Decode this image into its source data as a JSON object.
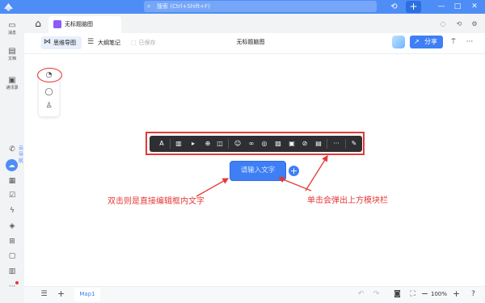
{
  "topbar": {
    "search_placeholder": "搜索 (Ctrl+Shift+F)",
    "plus_label": "+",
    "history_icon": "history-icon",
    "window_controls": [
      "minimize",
      "maximize",
      "close"
    ]
  },
  "rail": {
    "items": [
      {
        "icon": "chat-icon",
        "label": "消息"
      },
      {
        "icon": "document-icon",
        "label": "文档"
      },
      {
        "icon": "contacts-icon",
        "label": "通讯录"
      }
    ],
    "cloud_label": "云导航"
  },
  "tabstrip": {
    "tab_title": "无标题脑图"
  },
  "doc_toolbar": {
    "mindmap_label": "思维导图",
    "outline_label": "大纲笔记",
    "saved_label": "已保存",
    "title": "无标题脑图",
    "share_label": "分享",
    "more_label": "···"
  },
  "floating_bar": {
    "more_label": "···"
  },
  "node": {
    "placeholder": "请输入文字",
    "add_label": "+"
  },
  "annotations": {
    "left": "双击则是直接编辑框内文字",
    "right": "单击会弹出上方模块栏"
  },
  "bottombar": {
    "map_tab": "Map1",
    "zoom": "100%"
  },
  "colors": {
    "brand": "#4f8df6",
    "accent": "#3e7ff5",
    "annotation": "#e53935",
    "module_bar": "#2f2f33"
  }
}
